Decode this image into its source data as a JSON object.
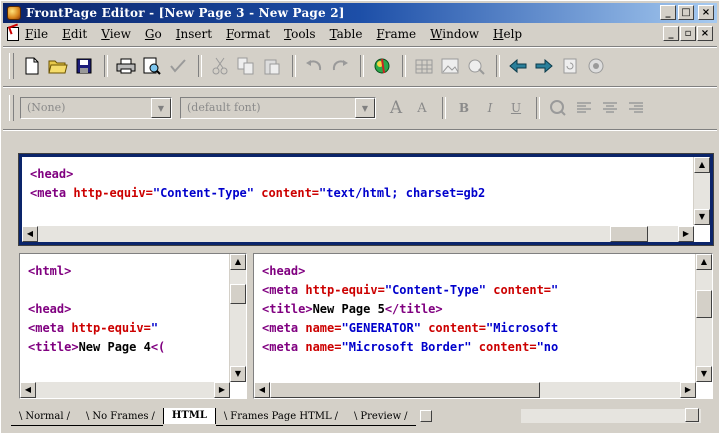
{
  "window": {
    "title": "FrontPage Editor - [New Page 3 - New Page 2]",
    "caption_buttons": [
      "_",
      "□",
      "×"
    ],
    "mdi_buttons": [
      "_",
      "▫",
      "×"
    ]
  },
  "menu": {
    "items": [
      "File",
      "Edit",
      "View",
      "Go",
      "Insert",
      "Format",
      "Tools",
      "Table",
      "Frame",
      "Window",
      "Help"
    ]
  },
  "toolbar_standard": {
    "icons": [
      "new-icon",
      "open-icon",
      "save-icon",
      "print-icon",
      "preview-icon",
      "spelling-icon",
      "cut-icon",
      "copy-icon",
      "paste-icon",
      "undo-icon",
      "redo-icon",
      "webbot-icon",
      "table-icon",
      "image-icon",
      "link-icon",
      "back-icon",
      "forward-icon",
      "refresh-icon",
      "stop-icon"
    ]
  },
  "toolbar_format": {
    "style_combo": "(None)",
    "font_combo": "(default font)",
    "buttons": [
      "A",
      "A",
      "B",
      "I",
      "U"
    ]
  },
  "top_pane": {
    "lines": [
      [
        {
          "t": "tag",
          "v": "<head>"
        }
      ],
      [
        {
          "t": "tag",
          "v": "<meta "
        },
        {
          "t": "attr",
          "v": "http-equiv="
        },
        {
          "t": "val",
          "v": "\"Content-Type\""
        },
        {
          "t": "attr",
          "v": " content="
        },
        {
          "t": "val",
          "v": "\"text/html; charset=gb2"
        }
      ]
    ]
  },
  "left_pane": {
    "lines": [
      [
        {
          "t": "tag",
          "v": "<html>"
        }
      ],
      [
        {
          "t": "txt",
          "v": ""
        }
      ],
      [
        {
          "t": "tag",
          "v": "<head>"
        }
      ],
      [
        {
          "t": "tag",
          "v": "<meta "
        },
        {
          "t": "attr",
          "v": "http-equiv="
        },
        {
          "t": "val",
          "v": "\""
        }
      ],
      [
        {
          "t": "tag",
          "v": "<title>"
        },
        {
          "t": "txt",
          "v": "New Page 4"
        },
        {
          "t": "tag",
          "v": "<("
        }
      ]
    ]
  },
  "right_pane": {
    "lines": [
      [
        {
          "t": "tag",
          "v": "<head>"
        }
      ],
      [
        {
          "t": "tag",
          "v": "<meta "
        },
        {
          "t": "attr",
          "v": "http-equiv="
        },
        {
          "t": "val",
          "v": "\"Content-Type\""
        },
        {
          "t": "attr",
          "v": " content="
        },
        {
          "t": "val",
          "v": "\""
        }
      ],
      [
        {
          "t": "tag",
          "v": "<title>"
        },
        {
          "t": "txt",
          "v": "New Page 5"
        },
        {
          "t": "tag",
          "v": "</title>"
        }
      ],
      [
        {
          "t": "tag",
          "v": "<meta "
        },
        {
          "t": "attr",
          "v": "name="
        },
        {
          "t": "val",
          "v": "\"GENERATOR\""
        },
        {
          "t": "attr",
          "v": " content="
        },
        {
          "t": "val",
          "v": "\"Microsoft"
        }
      ],
      [
        {
          "t": "tag",
          "v": "<meta "
        },
        {
          "t": "attr",
          "v": "name="
        },
        {
          "t": "val",
          "v": "\"Microsoft Border\""
        },
        {
          "t": "attr",
          "v": " content="
        },
        {
          "t": "val",
          "v": "\"no"
        }
      ]
    ]
  },
  "tabs": {
    "items": [
      "Normal",
      "No Frames",
      "HTML",
      "Frames Page HTML",
      "Preview"
    ],
    "active": "HTML"
  }
}
